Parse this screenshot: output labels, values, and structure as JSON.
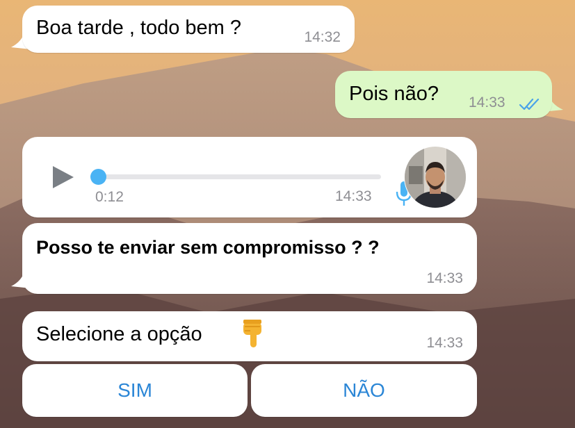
{
  "messages": [
    {
      "direction": "incoming",
      "text": "Boa tarde , todo bem ?",
      "time": "14:32"
    },
    {
      "direction": "outgoing",
      "text": "Pois não?",
      "time": "14:33",
      "status_icon": "double-check-read-icon"
    },
    {
      "direction": "incoming",
      "type": "voice",
      "duration": "0:12",
      "time": "14:33",
      "progress": 0.0,
      "icons": [
        "play-icon",
        "microphone-icon",
        "avatar"
      ]
    },
    {
      "direction": "incoming",
      "text": "Posso te enviar sem compromisso  ? ?",
      "time": "14:33"
    },
    {
      "direction": "incoming",
      "text": "Selecione a opção",
      "emoji_icon": "pointing-down-hand-icon",
      "time": "14:33"
    }
  ],
  "quick_replies": [
    {
      "label": "SIM"
    },
    {
      "label": "NÃO"
    }
  ],
  "colors": {
    "incoming_bubble": "#ffffff",
    "outgoing_bubble": "#dcf8c6",
    "timestamp": "#8e8e93",
    "read_ticks": "#4aa3e8",
    "button_text": "#2b86d6",
    "voice_progress": "#4ab3f4",
    "play_icon": "#7a7f85"
  }
}
